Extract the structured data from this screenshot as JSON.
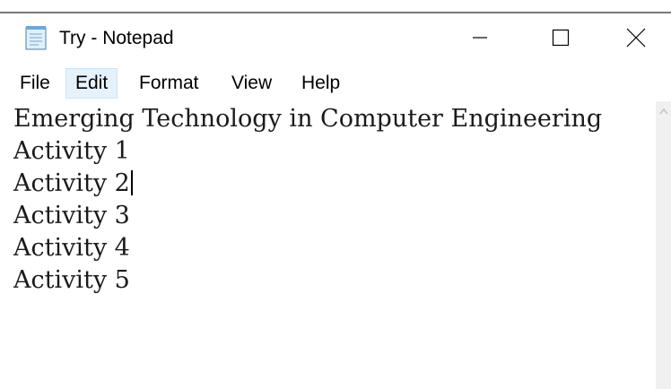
{
  "window": {
    "title": "Try - Notepad",
    "icon": "notepad-icon",
    "controls": {
      "minimize_icon": "minimize-icon",
      "maximize_icon": "maximize-icon",
      "close_icon": "close-icon"
    }
  },
  "menu": {
    "items": [
      {
        "label": "File"
      },
      {
        "label": "Edit",
        "active": true
      },
      {
        "label": "Format"
      },
      {
        "label": "View"
      },
      {
        "label": "Help"
      }
    ]
  },
  "document": {
    "lines": [
      "Emerging Technology in Computer Engineering",
      "Activity 1",
      "Activity 2",
      "Activity 3",
      "Activity 4",
      "Activity 5"
    ],
    "caret_line": 2
  },
  "colors": {
    "menu_highlight": "#e5f1fb",
    "menu_highlight_border": "#cce4f7",
    "scrollbar_track": "#f0f0f0"
  }
}
